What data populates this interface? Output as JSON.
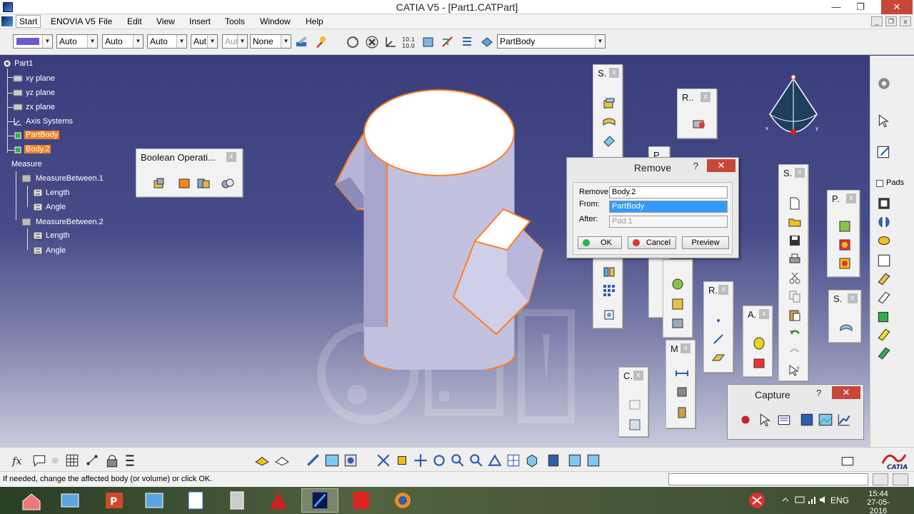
{
  "window": {
    "title": "CATIA V5 - [Part1.CATPart]",
    "minimize": "—",
    "maximize": "❐",
    "close": "✕"
  },
  "menu": {
    "start": "Start",
    "enovia": "ENOVIA V5",
    "file": "File",
    "edit": "Edit",
    "view": "View",
    "insert": "Insert",
    "tools": "Tools",
    "window": "Window",
    "help": "Help"
  },
  "graphic_props": {
    "color": "#6a5acd",
    "transparency": "Auto",
    "line_thickness": "Auto",
    "line_type": "Auto",
    "point_type": "Aut",
    "rendering": "Aut",
    "layer": "None",
    "current_body": "PartBody"
  },
  "tree": {
    "root": "Part1",
    "xy": "xy plane",
    "yz": "yz plane",
    "zx": "zx plane",
    "axis": "Axis Systems",
    "partbody": "PartBody",
    "body2": "Body.2",
    "measure": "Measure",
    "mb1": "MeasureBetween.1",
    "mb1_len": "Length",
    "mb1_ang": "Angle",
    "mb2": "MeasureBetween.2",
    "mb2_len": "Length",
    "mb2_ang": "Angle"
  },
  "boolean_toolbar": {
    "title": "Boolean Operati..."
  },
  "floating_toolbars": {
    "s1": "S.",
    "r1": "R..",
    "p_hidden": "P",
    "s2": "S.",
    "p2": "P.",
    "r2": "R.",
    "a1": "A.",
    "s3": "S.",
    "m1": "M",
    "c1": "C."
  },
  "remove_dialog": {
    "title": "Remove",
    "help": "?",
    "remove_label": "Remove:",
    "remove_value": "Body.2",
    "from_label": "From:",
    "from_value": "PartBody",
    "after_label": "After:",
    "after_value": "Pad.1",
    "ok": "OK",
    "cancel": "Cancel",
    "preview": "Preview"
  },
  "capture": {
    "title": "Capture",
    "help": "?"
  },
  "right_toolbar": {
    "pads": "Pads"
  },
  "status": {
    "message": "If needed, change the affected body (or volume) or click OK."
  },
  "taskbar": {
    "lang": "ENG",
    "time": "15:44",
    "date": "27-05-2016"
  },
  "colors": {
    "selection_orange": "#f28022",
    "viewport_top": "#3a3d7c",
    "close_red": "#c7473b"
  }
}
